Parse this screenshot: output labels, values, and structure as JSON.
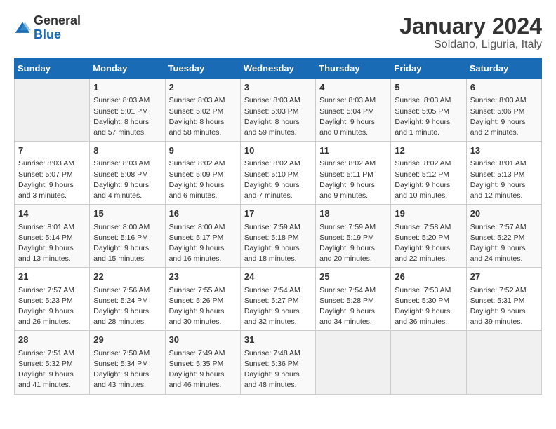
{
  "logo": {
    "text_general": "General",
    "text_blue": "Blue"
  },
  "calendar": {
    "title": "January 2024",
    "subtitle": "Soldano, Liguria, Italy"
  },
  "headers": [
    "Sunday",
    "Monday",
    "Tuesday",
    "Wednesday",
    "Thursday",
    "Friday",
    "Saturday"
  ],
  "weeks": [
    [
      {
        "day": "",
        "info": ""
      },
      {
        "day": "1",
        "info": "Sunrise: 8:03 AM\nSunset: 5:01 PM\nDaylight: 8 hours\nand 57 minutes."
      },
      {
        "day": "2",
        "info": "Sunrise: 8:03 AM\nSunset: 5:02 PM\nDaylight: 8 hours\nand 58 minutes."
      },
      {
        "day": "3",
        "info": "Sunrise: 8:03 AM\nSunset: 5:03 PM\nDaylight: 8 hours\nand 59 minutes."
      },
      {
        "day": "4",
        "info": "Sunrise: 8:03 AM\nSunset: 5:04 PM\nDaylight: 9 hours\nand 0 minutes."
      },
      {
        "day": "5",
        "info": "Sunrise: 8:03 AM\nSunset: 5:05 PM\nDaylight: 9 hours\nand 1 minute."
      },
      {
        "day": "6",
        "info": "Sunrise: 8:03 AM\nSunset: 5:06 PM\nDaylight: 9 hours\nand 2 minutes."
      }
    ],
    [
      {
        "day": "7",
        "info": "Sunrise: 8:03 AM\nSunset: 5:07 PM\nDaylight: 9 hours\nand 3 minutes."
      },
      {
        "day": "8",
        "info": "Sunrise: 8:03 AM\nSunset: 5:08 PM\nDaylight: 9 hours\nand 4 minutes."
      },
      {
        "day": "9",
        "info": "Sunrise: 8:02 AM\nSunset: 5:09 PM\nDaylight: 9 hours\nand 6 minutes."
      },
      {
        "day": "10",
        "info": "Sunrise: 8:02 AM\nSunset: 5:10 PM\nDaylight: 9 hours\nand 7 minutes."
      },
      {
        "day": "11",
        "info": "Sunrise: 8:02 AM\nSunset: 5:11 PM\nDaylight: 9 hours\nand 9 minutes."
      },
      {
        "day": "12",
        "info": "Sunrise: 8:02 AM\nSunset: 5:12 PM\nDaylight: 9 hours\nand 10 minutes."
      },
      {
        "day": "13",
        "info": "Sunrise: 8:01 AM\nSunset: 5:13 PM\nDaylight: 9 hours\nand 12 minutes."
      }
    ],
    [
      {
        "day": "14",
        "info": "Sunrise: 8:01 AM\nSunset: 5:14 PM\nDaylight: 9 hours\nand 13 minutes."
      },
      {
        "day": "15",
        "info": "Sunrise: 8:00 AM\nSunset: 5:16 PM\nDaylight: 9 hours\nand 15 minutes."
      },
      {
        "day": "16",
        "info": "Sunrise: 8:00 AM\nSunset: 5:17 PM\nDaylight: 9 hours\nand 16 minutes."
      },
      {
        "day": "17",
        "info": "Sunrise: 7:59 AM\nSunset: 5:18 PM\nDaylight: 9 hours\nand 18 minutes."
      },
      {
        "day": "18",
        "info": "Sunrise: 7:59 AM\nSunset: 5:19 PM\nDaylight: 9 hours\nand 20 minutes."
      },
      {
        "day": "19",
        "info": "Sunrise: 7:58 AM\nSunset: 5:20 PM\nDaylight: 9 hours\nand 22 minutes."
      },
      {
        "day": "20",
        "info": "Sunrise: 7:57 AM\nSunset: 5:22 PM\nDaylight: 9 hours\nand 24 minutes."
      }
    ],
    [
      {
        "day": "21",
        "info": "Sunrise: 7:57 AM\nSunset: 5:23 PM\nDaylight: 9 hours\nand 26 minutes."
      },
      {
        "day": "22",
        "info": "Sunrise: 7:56 AM\nSunset: 5:24 PM\nDaylight: 9 hours\nand 28 minutes."
      },
      {
        "day": "23",
        "info": "Sunrise: 7:55 AM\nSunset: 5:26 PM\nDaylight: 9 hours\nand 30 minutes."
      },
      {
        "day": "24",
        "info": "Sunrise: 7:54 AM\nSunset: 5:27 PM\nDaylight: 9 hours\nand 32 minutes."
      },
      {
        "day": "25",
        "info": "Sunrise: 7:54 AM\nSunset: 5:28 PM\nDaylight: 9 hours\nand 34 minutes."
      },
      {
        "day": "26",
        "info": "Sunrise: 7:53 AM\nSunset: 5:30 PM\nDaylight: 9 hours\nand 36 minutes."
      },
      {
        "day": "27",
        "info": "Sunrise: 7:52 AM\nSunset: 5:31 PM\nDaylight: 9 hours\nand 39 minutes."
      }
    ],
    [
      {
        "day": "28",
        "info": "Sunrise: 7:51 AM\nSunset: 5:32 PM\nDaylight: 9 hours\nand 41 minutes."
      },
      {
        "day": "29",
        "info": "Sunrise: 7:50 AM\nSunset: 5:34 PM\nDaylight: 9 hours\nand 43 minutes."
      },
      {
        "day": "30",
        "info": "Sunrise: 7:49 AM\nSunset: 5:35 PM\nDaylight: 9 hours\nand 46 minutes."
      },
      {
        "day": "31",
        "info": "Sunrise: 7:48 AM\nSunset: 5:36 PM\nDaylight: 9 hours\nand 48 minutes."
      },
      {
        "day": "",
        "info": ""
      },
      {
        "day": "",
        "info": ""
      },
      {
        "day": "",
        "info": ""
      }
    ]
  ]
}
